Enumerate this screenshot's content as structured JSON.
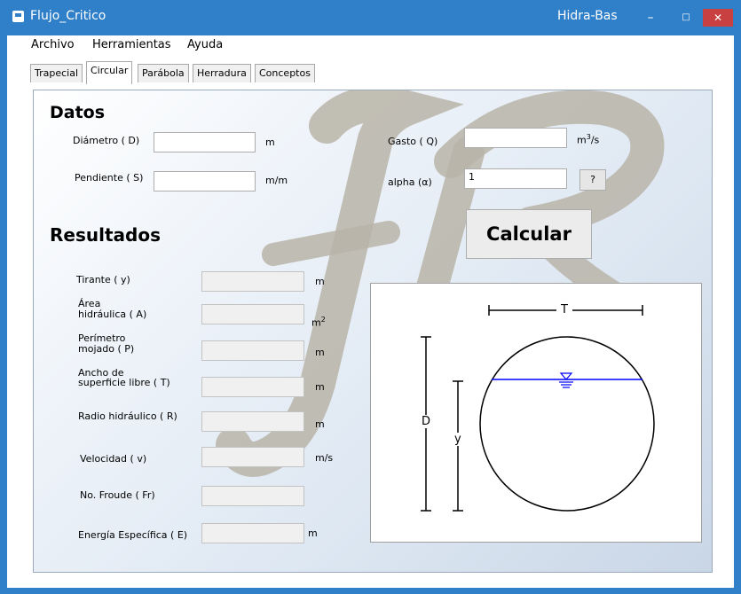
{
  "window": {
    "title": "Flujo_Critico",
    "brand": "Hidra-Bas",
    "minimize": "–",
    "maximize": "□",
    "close": "✕"
  },
  "menu": {
    "items": [
      "Archivo",
      "Herramientas",
      "Ayuda"
    ]
  },
  "tabs": [
    "Trapecial",
    "Circular",
    "Parábola",
    "Herradura",
    "Conceptos"
  ],
  "active_tab": "Circular",
  "datos": {
    "heading": "Datos",
    "diametro_label": "Diámetro ( D)",
    "diametro_value": "",
    "diametro_unit": "m",
    "pendiente_label": "Pendiente ( S)",
    "pendiente_value": "",
    "pendiente_unit": "m/m",
    "gasto_label": "Gasto ( Q)",
    "gasto_value": "",
    "gasto_unit_base": "m",
    "gasto_unit_exp": "3",
    "gasto_unit_tail": "/s",
    "alpha_label": "alpha  (α)",
    "alpha_value": "1",
    "help_label": "?"
  },
  "calcular_label": "Calcular",
  "resultados": {
    "heading": "Resultados",
    "tirante_label": "Tirante ( y)",
    "tirante_unit": "m",
    "area_label_1": "Área",
    "area_label_2": "hidráulica ( A)",
    "area_unit_base": "m",
    "area_unit_exp": "2",
    "perimetro_label_1": "Perímetro",
    "perimetro_label_2": "mojado ( P)",
    "perimetro_unit": "m",
    "ancho_label_1": "Ancho de",
    "ancho_label_2": "superficie libre ( T)",
    "ancho_unit": "m",
    "radio_label": "Radio hidráulico ( R)",
    "radio_unit": "m",
    "velocidad_label": "Velocidad ( v)",
    "velocidad_unit": "m/s",
    "froude_label": "No. Froude ( Fr)",
    "energia_label": "Energía Específica ( E)",
    "energia_unit": "m",
    "values": [
      "",
      "",
      "",
      "",
      "",
      "",
      "",
      ""
    ]
  },
  "diagram": {
    "T_label": "T",
    "D_label": "D",
    "y_label": "y",
    "water_color": "#0000ff"
  },
  "colors": {
    "titlebar": "#2f7fc9",
    "close_button": "#c94040",
    "logo_watermark": "#aeaaa0"
  }
}
